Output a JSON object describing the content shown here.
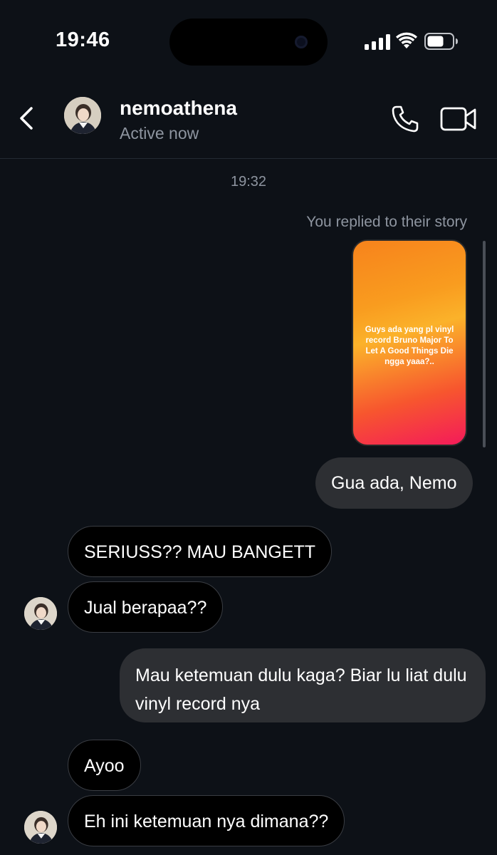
{
  "status_bar": {
    "time": "19:46"
  },
  "header": {
    "username": "nemoathena",
    "presence": "Active now"
  },
  "chat": {
    "timestamp": "19:32",
    "reply_note": "You replied to their story",
    "story_text": "Guys ada yang pl vinyl record Bruno Major To Let A Good Things Die ngga yaaa?..",
    "messages": [
      {
        "from": "me",
        "text": "Gua ada, Nemo"
      },
      {
        "from": "them",
        "text": "SERIUSS?? MAU BANGETT"
      },
      {
        "from": "them",
        "text": "Jual berapaa??"
      },
      {
        "from": "me",
        "text": "Mau ketemuan dulu kaga? Biar lu liat dulu vinyl record nya"
      },
      {
        "from": "them",
        "text": "Ayoo"
      },
      {
        "from": "them",
        "text": "Eh ini ketemuan nya dimana??"
      }
    ]
  },
  "colors": {
    "background": "#0d1117",
    "outgoing_bubble": "#2d2f33",
    "incoming_bubble": "#000000",
    "secondary_text": "#8e95a0"
  },
  "icons": {
    "back": "chevron-left-icon",
    "call": "phone-icon",
    "video": "video-camera-icon",
    "signal": "cellular-signal-icon",
    "wifi": "wifi-icon",
    "battery": "battery-icon"
  }
}
